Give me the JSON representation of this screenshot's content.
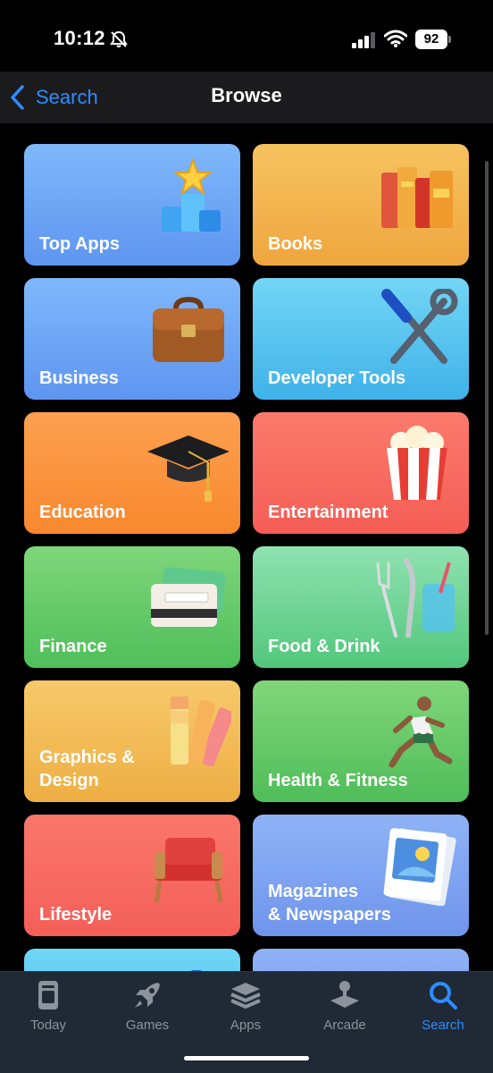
{
  "status_bar": {
    "time": "10:12",
    "battery": "92",
    "icons": [
      "bell-slash-icon",
      "signal-icon",
      "wifi-icon",
      "battery-icon"
    ]
  },
  "nav": {
    "back_label": "Search",
    "title": "Browse"
  },
  "categories": [
    {
      "label": "Top Apps",
      "icon": "podium-star-icon",
      "color": "#6fa7f7"
    },
    {
      "label": "Books",
      "icon": "books-icon",
      "color": "#f3b650"
    },
    {
      "label": "Business",
      "icon": "briefcase-icon",
      "color": "#6fa7f7"
    },
    {
      "label": "Developer Tools",
      "icon": "screwdriver-wrench-icon",
      "color": "#55c4ef"
    },
    {
      "label": "Education",
      "icon": "graduation-cap-icon",
      "color": "#fb943f"
    },
    {
      "label": "Entertainment",
      "icon": "popcorn-icon",
      "color": "#f86b60"
    },
    {
      "label": "Finance",
      "icon": "credit-card-icon",
      "color": "#68cb6a"
    },
    {
      "label": "Food & Drink",
      "icon": "fork-knife-glass-icon",
      "color": "#6fd596"
    },
    {
      "label": "Graphics &\nDesign",
      "icon": "color-swatch-icon",
      "color": "#f2bc57"
    },
    {
      "label": "Health & Fitness",
      "icon": "runner-icon",
      "color": "#68ca69"
    },
    {
      "label": "Lifestyle",
      "icon": "armchair-icon",
      "color": "#f76a61"
    },
    {
      "label": "Magazines\n& Newspapers",
      "icon": "magazine-icon",
      "color": "#7fa4f1"
    },
    {
      "label": "",
      "icon": "partial-tile-icon",
      "color": "#5ccaf0"
    },
    {
      "label": "",
      "icon": "partial-tile-icon",
      "color": "#7fa4f1"
    }
  ],
  "tabs": [
    {
      "label": "Today",
      "icon": "today-icon",
      "active": false
    },
    {
      "label": "Games",
      "icon": "rocket-icon",
      "active": false
    },
    {
      "label": "Apps",
      "icon": "layers-icon",
      "active": false
    },
    {
      "label": "Arcade",
      "icon": "joystick-icon",
      "active": false
    },
    {
      "label": "Search",
      "icon": "search-icon",
      "active": true
    }
  ],
  "colors": {
    "accent": "#2f8cff",
    "tab_inactive": "#8c939c",
    "nav_background": "#1b1b1d",
    "tab_background": "#1f2a36"
  }
}
